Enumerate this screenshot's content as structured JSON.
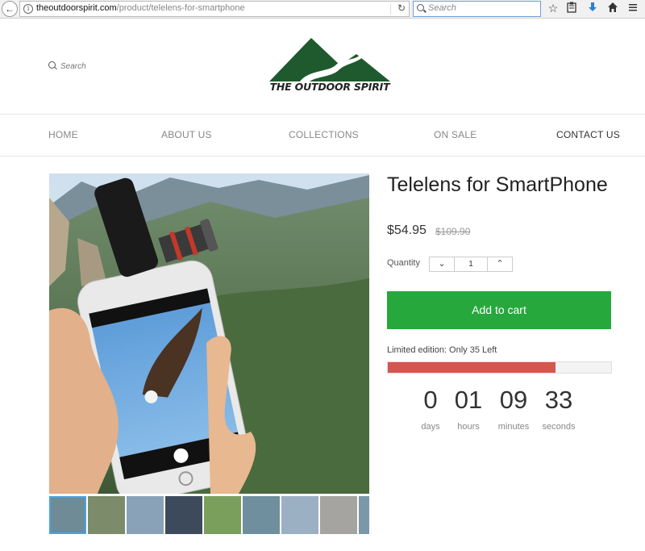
{
  "browser": {
    "url_domain": "theoutdoorspirit.com",
    "url_path": "/product/telelens-for-smartphone",
    "search_placeholder": "Search"
  },
  "header": {
    "search_label": "Search",
    "logo_text": "THE OUTDOOR SPIRIT",
    "brand_color": "#1e5a2d"
  },
  "nav": {
    "items": [
      {
        "label": "HOME"
      },
      {
        "label": "ABOUT US"
      },
      {
        "label": "COLLECTIONS"
      },
      {
        "label": "ON SALE"
      },
      {
        "label": "CONTACT US"
      }
    ]
  },
  "product": {
    "title": "Telelens for SmartPhone",
    "price": "$54.95",
    "compare_price": "$109.90",
    "quantity_label": "Quantity",
    "quantity": "1",
    "add_to_cart": "Add to cart",
    "stock_text": "Limited edition: Only 35 Left",
    "stock_fraction": 0.75,
    "accent_color": "#26a83c",
    "stock_color": "#d9534f",
    "thumbnail_count": 9
  },
  "countdown": {
    "days": "0",
    "hours": "01",
    "minutes": "09",
    "seconds": "33",
    "labels": {
      "days": "days",
      "hours": "hours",
      "minutes": "minutes",
      "seconds": "seconds"
    }
  }
}
